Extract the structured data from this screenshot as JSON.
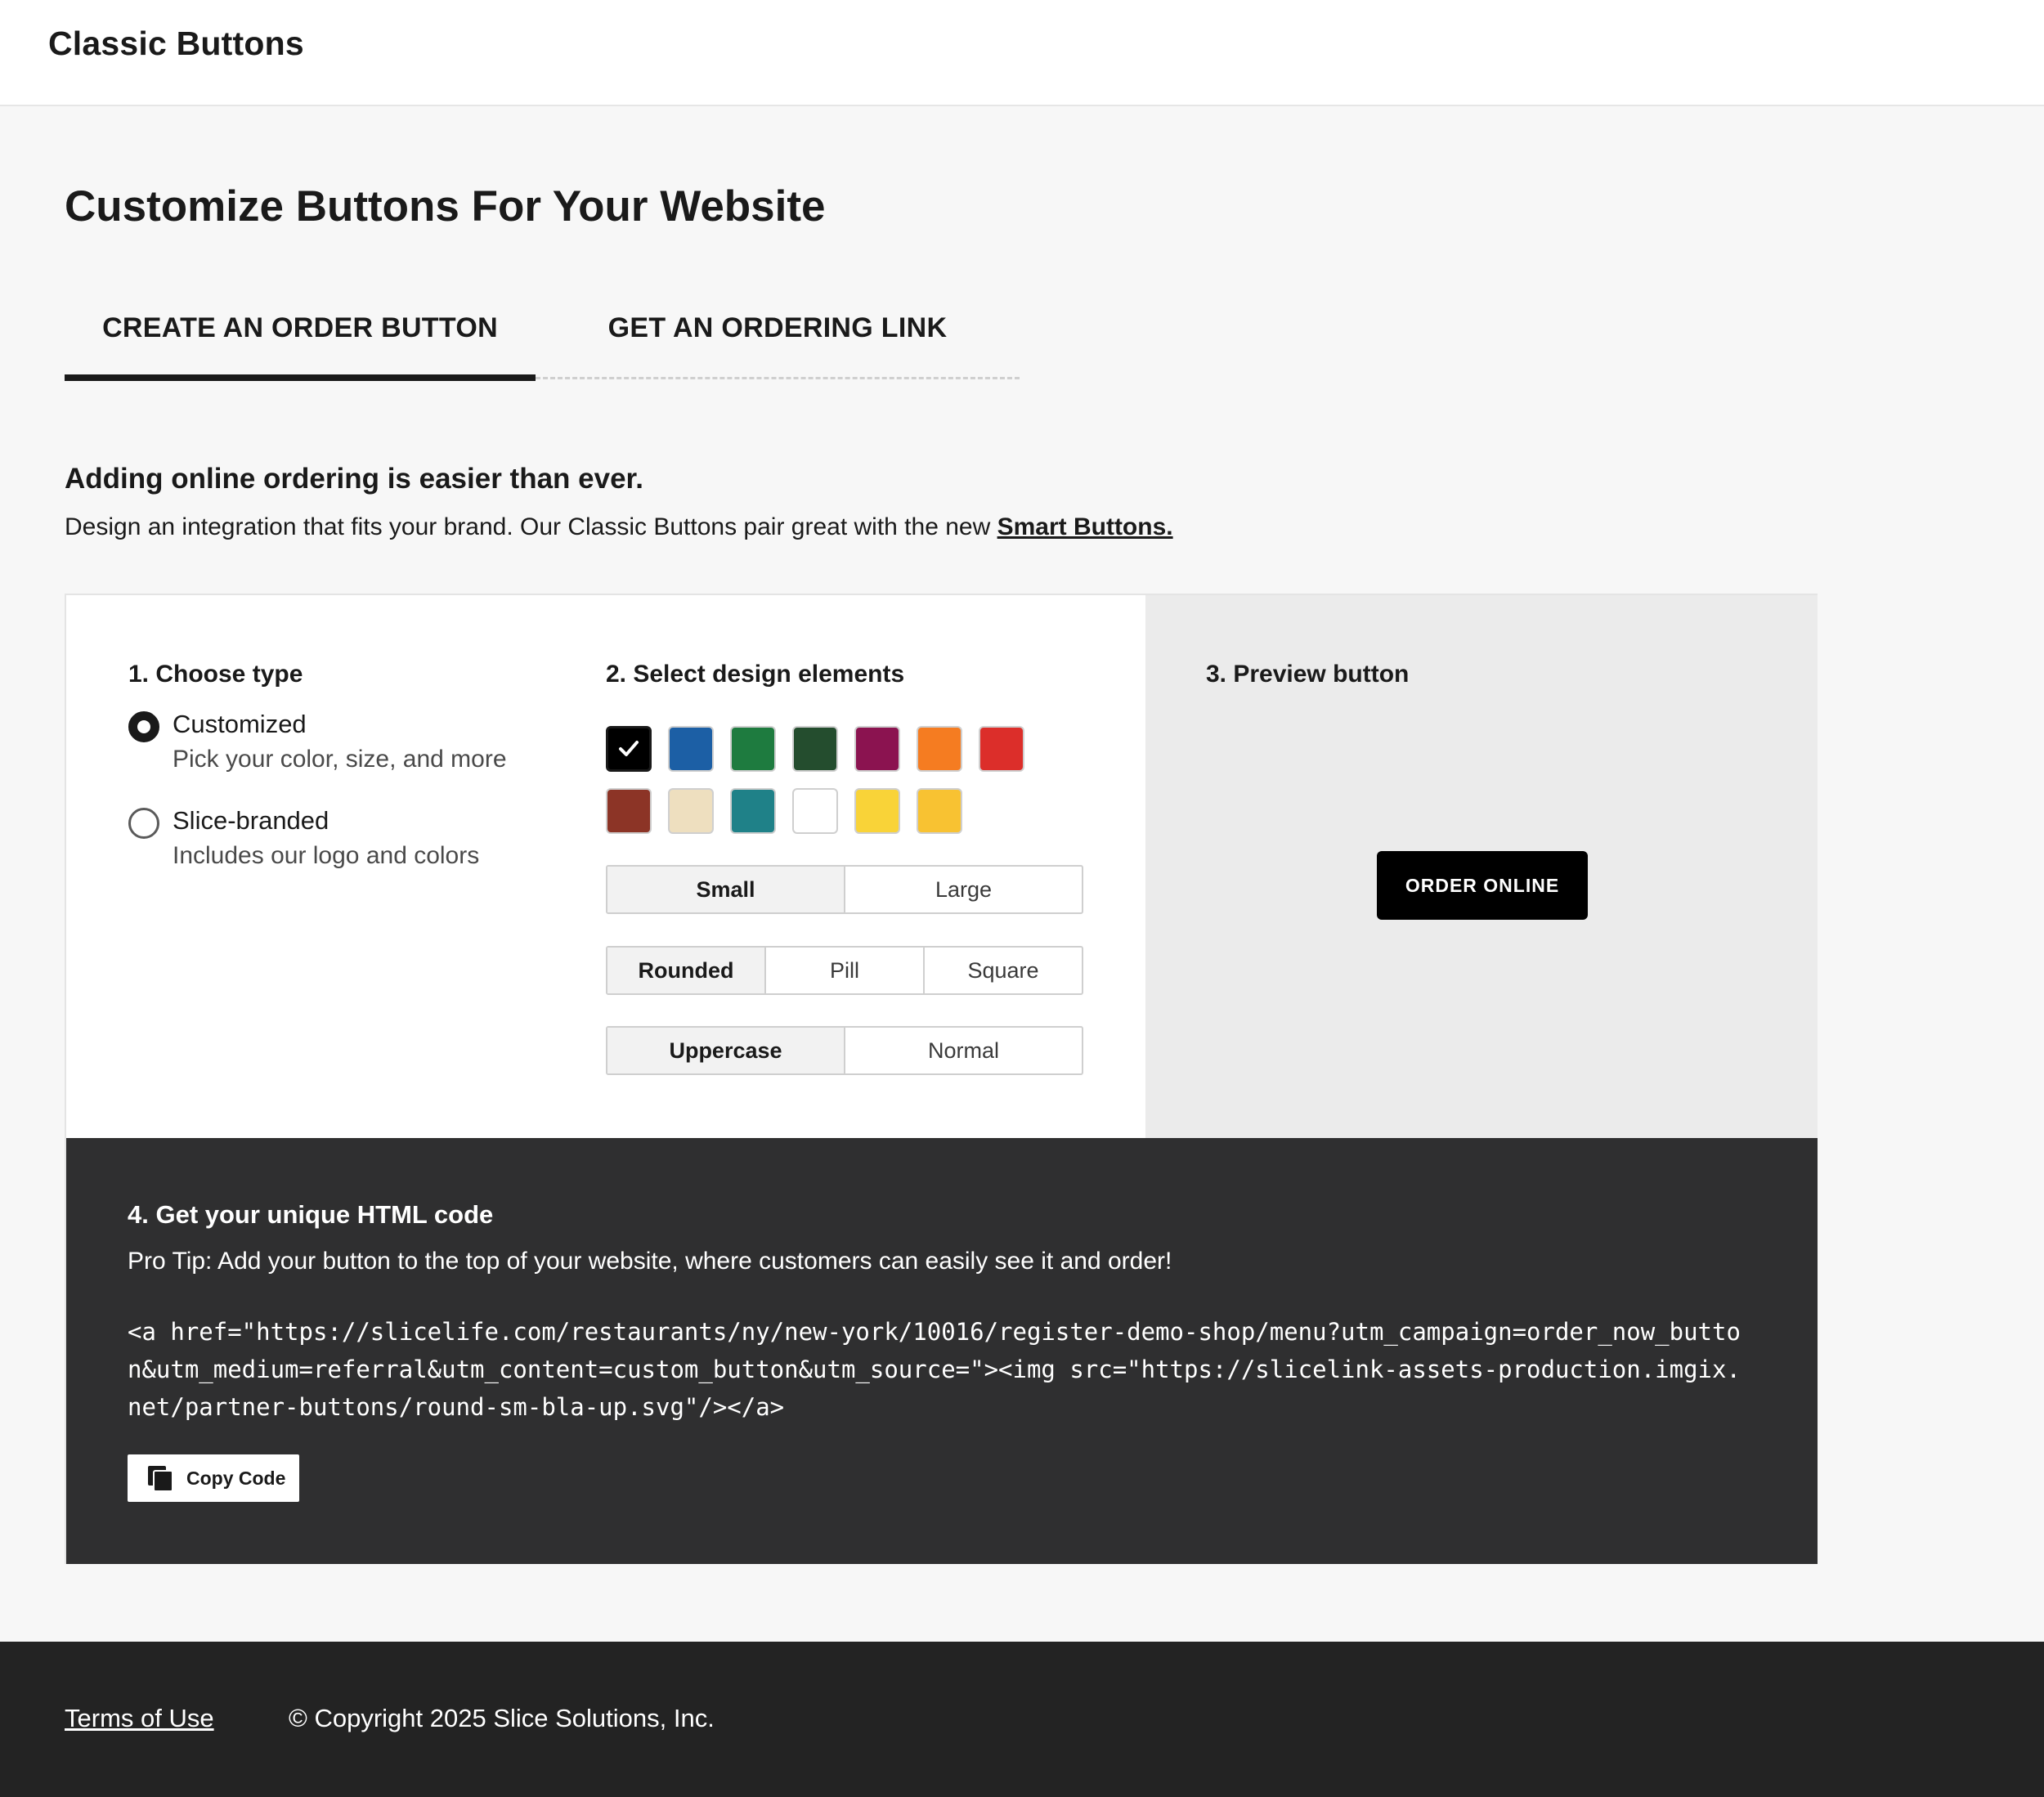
{
  "header": {
    "title": "Classic Buttons"
  },
  "main": {
    "title": "Customize Buttons For Your Website",
    "tabs": [
      {
        "label": "CREATE AN ORDER BUTTON",
        "active": true
      },
      {
        "label": "GET AN ORDERING LINK",
        "active": false
      }
    ],
    "intro": {
      "heading": "Adding online ordering is easier than ever.",
      "text": "Design an integration that fits your brand. Our Classic Buttons pair great with the new ",
      "link": "Smart Buttons."
    }
  },
  "step1": {
    "title": "1. Choose type",
    "options": [
      {
        "label": "Customized",
        "sub": "Pick your color, size, and more",
        "checked": true
      },
      {
        "label": "Slice-branded",
        "sub": "Includes our logo and colors",
        "checked": false
      }
    ]
  },
  "step2": {
    "title": "2. Select design elements",
    "colors": [
      {
        "name": "black",
        "hex": "#000000",
        "selected": true
      },
      {
        "name": "blue",
        "hex": "#1c5fa5"
      },
      {
        "name": "green",
        "hex": "#1e7b3f"
      },
      {
        "name": "dark-green",
        "hex": "#244d2e"
      },
      {
        "name": "magenta",
        "hex": "#8b1350"
      },
      {
        "name": "orange",
        "hex": "#f57c21"
      },
      {
        "name": "red",
        "hex": "#dc2e2a"
      },
      {
        "name": "brown",
        "hex": "#8c3426"
      },
      {
        "name": "cream",
        "hex": "#eedfbf"
      },
      {
        "name": "teal",
        "hex": "#1f8188"
      },
      {
        "name": "white",
        "hex": "#ffffff"
      },
      {
        "name": "yellow",
        "hex": "#f9d338"
      },
      {
        "name": "gold",
        "hex": "#f8c232"
      }
    ],
    "size": {
      "options": [
        "Small",
        "Large"
      ],
      "selected": "Small"
    },
    "shape": {
      "options": [
        "Rounded",
        "Pill",
        "Square"
      ],
      "selected": "Rounded"
    },
    "case": {
      "options": [
        "Uppercase",
        "Normal"
      ],
      "selected": "Uppercase"
    }
  },
  "step3": {
    "title": "3. Preview button",
    "button_label": "ORDER ONLINE"
  },
  "step4": {
    "title": "4. Get your unique HTML code",
    "tip": "Pro Tip: Add your button to the top of your website, where customers can easily see it and order!",
    "code": "<a href=\"https://slicelife.com/restaurants/ny/new-york/10016/register-demo-shop/menu?utm_campaign=order_now_button&utm_medium=referral&utm_content=custom_button&utm_source=\"><img src=\"https://slicelink-assets-production.imgix.net/partner-buttons/round-sm-bla-up.svg\"/></a>",
    "copy_label": "Copy Code"
  },
  "footer": {
    "terms": "Terms of Use",
    "copyright": "© Copyright 2025 Slice Solutions, Inc."
  }
}
